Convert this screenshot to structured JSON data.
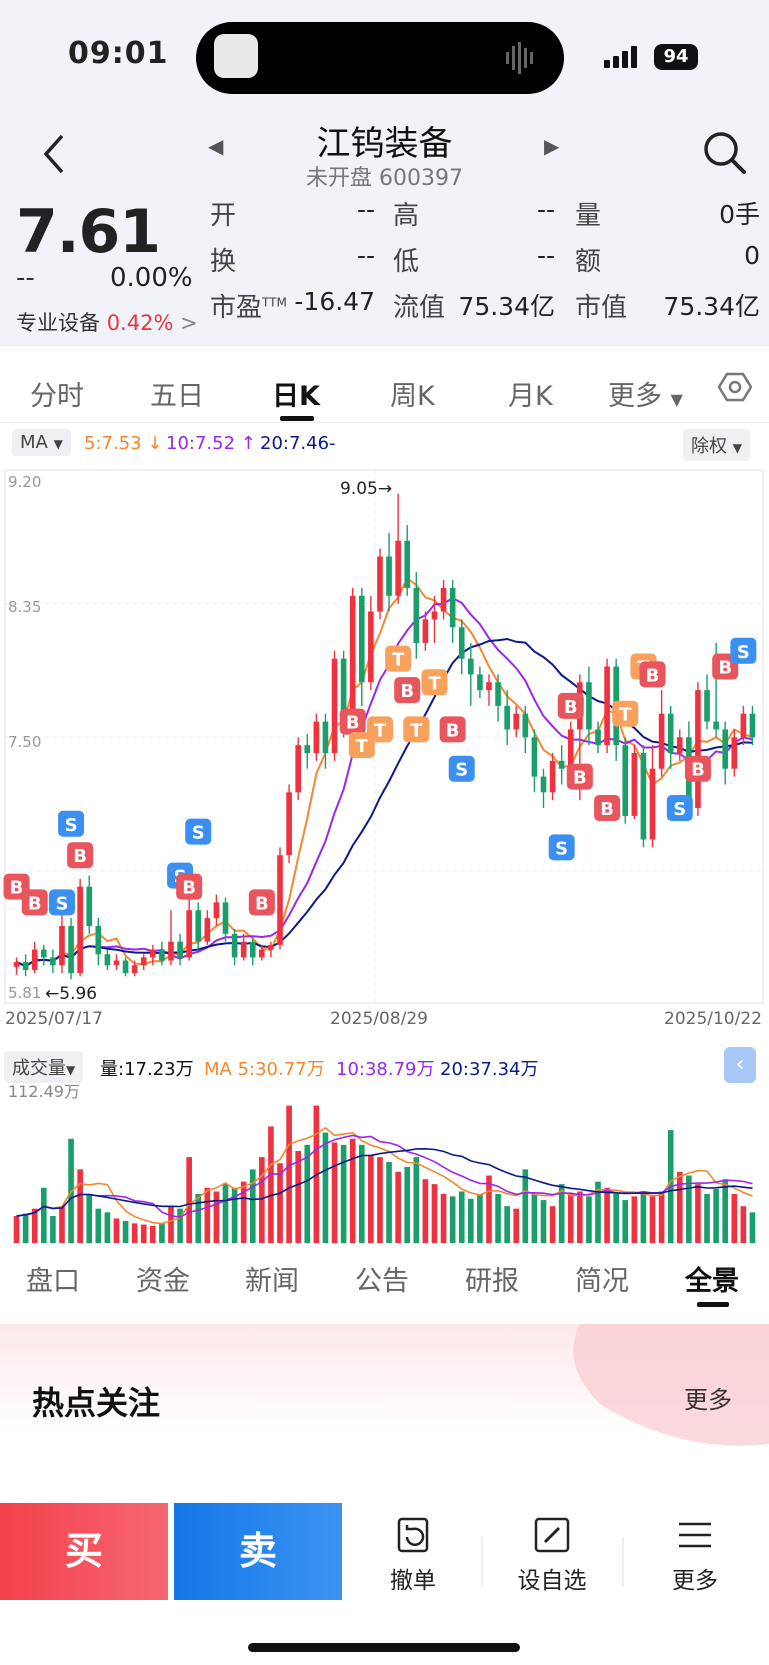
{
  "status": {
    "time": "09:01",
    "battery": "94"
  },
  "header": {
    "name": "江钨装备",
    "sub": "未开盘 600397"
  },
  "quote": {
    "price": "7.61",
    "change": "--",
    "change_pct": "0.00%",
    "industry": "专业设备",
    "industry_pct": "0.42%",
    "industry_arrow": ">",
    "fields": [
      {
        "label": "开",
        "value": "--"
      },
      {
        "label": "高",
        "value": "--"
      },
      {
        "label": "量",
        "value": "0手"
      },
      {
        "label": "换",
        "value": "--"
      },
      {
        "label": "低",
        "value": "--"
      },
      {
        "label": "额",
        "value": "0"
      },
      {
        "label": "市盈",
        "sup": "TTM",
        "value": "-16.47"
      },
      {
        "label": "流值",
        "value": "75.34亿"
      },
      {
        "label": "市值",
        "value": "75.34亿"
      }
    ]
  },
  "period_tabs": [
    "分时",
    "五日",
    "日K",
    "周K",
    "月K",
    "更多"
  ],
  "active_period": "日K",
  "ma": {
    "selector": "MA",
    "ma5": "5:7.53",
    "ma10": "10:7.52",
    "ma20": "20:7.46-",
    "adjust": "除权"
  },
  "colors": {
    "up": "#ee3240",
    "down": "#1a9e6a",
    "ma5": "#f5872f",
    "ma10": "#9a27f0",
    "ma20": "#0d1a8c",
    "buy_marker": "#e8555c",
    "sell_marker": "#3a8ff0",
    "t_marker": "#f7a15c"
  },
  "chart_data": {
    "type": "candlestick",
    "y_ticks": [
      "9.20",
      "8.35",
      "7.50",
      "5.81"
    ],
    "x_ticks": [
      "2025/07/17",
      "2025/08/29",
      "2025/10/22"
    ],
    "max_label": "9.05",
    "min_label": "5.96",
    "candles": [
      [
        6.04,
        6.07,
        5.99,
        6.1
      ],
      [
        6.07,
        6.02,
        5.98,
        6.12
      ],
      [
        6.02,
        6.15,
        6.0,
        6.2
      ],
      [
        6.15,
        6.1,
        6.05,
        6.18
      ],
      [
        6.1,
        6.05,
        6.0,
        6.15
      ],
      [
        6.05,
        6.3,
        6.0,
        6.4
      ],
      [
        6.3,
        6.0,
        5.96,
        6.35
      ],
      [
        6.0,
        6.55,
        5.98,
        6.6
      ],
      [
        6.55,
        6.3,
        6.25,
        6.62
      ],
      [
        6.3,
        6.12,
        6.05,
        6.35
      ],
      [
        6.12,
        6.05,
        6.02,
        6.15
      ],
      [
        6.05,
        6.08,
        6.02,
        6.12
      ],
      [
        6.08,
        6.0,
        5.98,
        6.1
      ],
      [
        6.0,
        6.05,
        5.98,
        6.08
      ],
      [
        6.05,
        6.1,
        6.02,
        6.12
      ],
      [
        6.1,
        6.15,
        6.05,
        6.18
      ],
      [
        6.15,
        6.08,
        6.05,
        6.2
      ],
      [
        6.08,
        6.2,
        6.05,
        6.4
      ],
      [
        6.2,
        6.1,
        6.05,
        6.25
      ],
      [
        6.1,
        6.4,
        6.08,
        6.5
      ],
      [
        6.4,
        6.2,
        6.15,
        6.45
      ],
      [
        6.2,
        6.35,
        6.18,
        6.4
      ],
      [
        6.35,
        6.45,
        6.3,
        6.5
      ],
      [
        6.45,
        6.25,
        6.2,
        6.48
      ],
      [
        6.25,
        6.1,
        6.05,
        6.28
      ],
      [
        6.1,
        6.2,
        6.08,
        6.25
      ],
      [
        6.2,
        6.1,
        6.05,
        6.22
      ],
      [
        6.1,
        6.15,
        6.08,
        6.18
      ],
      [
        6.15,
        6.18,
        6.1,
        6.2
      ],
      [
        6.18,
        6.75,
        6.15,
        6.8
      ],
      [
        6.75,
        7.15,
        6.7,
        7.2
      ],
      [
        7.15,
        7.45,
        7.1,
        7.5
      ],
      [
        7.45,
        7.4,
        7.3,
        7.52
      ],
      [
        7.4,
        7.6,
        7.35,
        7.65
      ],
      [
        7.6,
        7.4,
        7.3,
        7.65
      ],
      [
        7.4,
        8.0,
        7.35,
        8.05
      ],
      [
        8.0,
        7.6,
        7.5,
        8.05
      ],
      [
        7.6,
        8.4,
        7.55,
        8.45
      ],
      [
        8.4,
        7.85,
        7.7,
        8.45
      ],
      [
        7.85,
        8.3,
        7.8,
        8.4
      ],
      [
        8.3,
        8.65,
        8.25,
        8.7
      ],
      [
        8.65,
        8.4,
        8.3,
        8.8
      ],
      [
        8.4,
        8.75,
        8.35,
        9.05
      ],
      [
        8.75,
        8.45,
        8.4,
        8.85
      ],
      [
        8.45,
        8.1,
        8.0,
        8.55
      ],
      [
        8.1,
        8.25,
        8.05,
        8.3
      ],
      [
        8.25,
        8.3,
        8.1,
        8.4
      ],
      [
        8.3,
        8.45,
        8.25,
        8.5
      ],
      [
        8.45,
        8.2,
        8.1,
        8.5
      ],
      [
        8.2,
        8.0,
        7.9,
        8.25
      ],
      [
        8.0,
        7.9,
        7.7,
        8.1
      ],
      [
        7.9,
        7.8,
        7.75,
        7.95
      ],
      [
        7.8,
        7.85,
        7.7,
        7.9
      ],
      [
        7.85,
        7.7,
        7.6,
        7.9
      ],
      [
        7.7,
        7.55,
        7.45,
        7.8
      ],
      [
        7.55,
        7.65,
        7.5,
        7.7
      ],
      [
        7.65,
        7.5,
        7.4,
        7.7
      ],
      [
        7.5,
        7.25,
        7.15,
        7.55
      ],
      [
        7.25,
        7.15,
        7.05,
        7.3
      ],
      [
        7.15,
        7.35,
        7.1,
        7.4
      ],
      [
        7.35,
        7.3,
        7.2,
        7.45
      ],
      [
        7.3,
        7.55,
        7.25,
        7.6
      ],
      [
        7.55,
        7.85,
        7.1,
        7.9
      ],
      [
        7.85,
        7.55,
        7.45,
        7.95
      ],
      [
        7.55,
        7.45,
        7.4,
        7.6
      ],
      [
        7.45,
        7.95,
        7.4,
        8.0
      ],
      [
        7.95,
        7.45,
        7.35,
        8.0
      ],
      [
        7.45,
        7.0,
        6.95,
        7.5
      ],
      [
        7.0,
        7.4,
        6.98,
        7.45
      ],
      [
        7.4,
        6.85,
        6.8,
        7.45
      ],
      [
        6.85,
        7.3,
        6.8,
        7.45
      ],
      [
        7.3,
        7.65,
        7.25,
        7.8
      ],
      [
        7.65,
        7.4,
        7.3,
        7.7
      ],
      [
        7.4,
        7.5,
        7.35,
        7.55
      ],
      [
        7.5,
        7.05,
        7.0,
        7.6
      ],
      [
        7.05,
        7.8,
        7.0,
        7.85
      ],
      [
        7.8,
        7.6,
        7.55,
        7.9
      ],
      [
        7.6,
        7.55,
        7.5,
        8.1
      ],
      [
        7.55,
        7.3,
        7.2,
        7.6
      ],
      [
        7.3,
        7.5,
        7.25,
        7.55
      ],
      [
        7.5,
        7.65,
        7.45,
        7.7
      ],
      [
        7.65,
        7.5,
        7.45,
        7.7
      ]
    ],
    "markers": [
      {
        "label": "B",
        "i": 0,
        "p": 6.55
      },
      {
        "label": "B",
        "i": 2,
        "p": 6.45
      },
      {
        "label": "S",
        "i": 5,
        "p": 6.45
      },
      {
        "label": "S",
        "i": 6,
        "p": 6.95
      },
      {
        "label": "B",
        "i": 7,
        "p": 6.75
      },
      {
        "label": "S",
        "i": 18,
        "p": 6.62
      },
      {
        "label": "B",
        "i": 19,
        "p": 6.55
      },
      {
        "label": "S",
        "i": 20,
        "p": 6.9
      },
      {
        "label": "B",
        "i": 27,
        "p": 6.45
      },
      {
        "label": "B",
        "i": 37,
        "p": 7.6
      },
      {
        "label": "T",
        "i": 38,
        "p": 7.45
      },
      {
        "label": "T",
        "i": 40,
        "p": 7.55
      },
      {
        "label": "T",
        "i": 42,
        "p": 8.0
      },
      {
        "label": "B",
        "i": 43,
        "p": 7.8
      },
      {
        "label": "T",
        "i": 44,
        "p": 7.55
      },
      {
        "label": "T",
        "i": 46,
        "p": 7.85
      },
      {
        "label": "B",
        "i": 48,
        "p": 7.55
      },
      {
        "label": "S",
        "i": 49,
        "p": 7.3
      },
      {
        "label": "S",
        "i": 60,
        "p": 6.8
      },
      {
        "label": "B",
        "i": 61,
        "p": 7.7
      },
      {
        "label": "B",
        "i": 62,
        "p": 7.25
      },
      {
        "label": "B",
        "i": 65,
        "p": 7.05
      },
      {
        "label": "T",
        "i": 67,
        "p": 7.65
      },
      {
        "label": "T",
        "i": 69,
        "p": 7.95
      },
      {
        "label": "B",
        "i": 70,
        "p": 7.9
      },
      {
        "label": "S",
        "i": 73,
        "p": 7.05
      },
      {
        "label": "B",
        "i": 75,
        "p": 7.3
      },
      {
        "label": "B",
        "i": 78,
        "p": 7.95
      },
      {
        "label": "S",
        "i": 80,
        "p": 8.05
      }
    ],
    "volume": {
      "label": "成交量",
      "current": "量:17.23万",
      "ma5": "MA 5:30.77万",
      "ma10": "10:38.79万",
      "ma20": "20:37.34万",
      "max_label": "112.49万",
      "values": [
        22,
        24,
        28,
        45,
        22,
        30,
        85,
        60,
        40,
        28,
        25,
        20,
        18,
        16,
        15,
        14,
        16,
        30,
        28,
        70,
        40,
        45,
        42,
        48,
        45,
        50,
        60,
        70,
        95,
        65,
        112,
        75,
        80,
        112,
        90,
        82,
        80,
        85,
        80,
        72,
        70,
        66,
        58,
        62,
        70,
        52,
        48,
        40,
        38,
        42,
        36,
        40,
        55,
        40,
        30,
        28,
        60,
        40,
        35,
        30,
        48,
        40,
        42,
        38,
        50,
        45,
        40,
        35,
        38,
        42,
        38,
        42,
        92,
        58,
        55,
        48,
        40,
        44,
        52,
        40,
        30,
        25
      ]
    }
  },
  "bottom_tabs": [
    "盘口",
    "资金",
    "新闻",
    "公告",
    "研报",
    "简况",
    "全景"
  ],
  "active_bottom": "全景",
  "hot": {
    "title": "热点关注",
    "more": "更多"
  },
  "actions": {
    "buy": "买",
    "sell": "卖",
    "cancel": "撤单",
    "watch": "设自选",
    "more": "更多"
  }
}
